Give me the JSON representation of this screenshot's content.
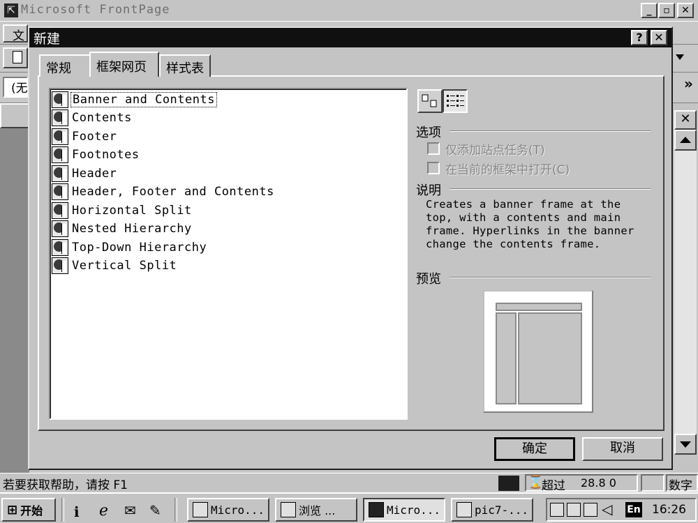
{
  "app": {
    "title": "Microsoft FrontPage",
    "min_glyph": "_",
    "max_glyph": "▫",
    "close_glyph": "✕"
  },
  "toolbars": {
    "menu_partial": "文",
    "style_partial": "(无",
    "overflow_glyph": "»"
  },
  "dialog": {
    "title": "新建",
    "help_glyph": "?",
    "close_glyph": "✕",
    "tabs": [
      {
        "label": "常规",
        "active": false
      },
      {
        "label": "框架网页",
        "active": true
      },
      {
        "label": "样式表",
        "active": false
      }
    ],
    "templates": [
      {
        "label": "Banner and Contents",
        "selected": true
      },
      {
        "label": "Contents",
        "selected": false
      },
      {
        "label": "Footer",
        "selected": false
      },
      {
        "label": "Footnotes",
        "selected": false
      },
      {
        "label": "Header",
        "selected": false
      },
      {
        "label": "Header, Footer and Contents",
        "selected": false
      },
      {
        "label": "Horizontal Split",
        "selected": false
      },
      {
        "label": "Nested Hierarchy",
        "selected": false
      },
      {
        "label": "Top-Down Hierarchy",
        "selected": false
      },
      {
        "label": "Vertical Split",
        "selected": false
      }
    ],
    "options": {
      "heading": "选项",
      "add_task_label": "仅添加站点任务(T)",
      "add_task_checked": false,
      "open_in_frame_label": "在当前的框架中打开(C)",
      "open_in_frame_checked": false
    },
    "description": {
      "heading": "说明",
      "text": "Creates a banner frame at the top, with a contents and main frame.  Hyperlinks in the banner change the contents frame."
    },
    "preview": {
      "heading": "预览"
    },
    "ok_label": "确定",
    "cancel_label": "取消"
  },
  "statusbar": {
    "help_text": "若要获取帮助，请按 F1",
    "timeout_label": "超过",
    "speed": "28.8 0",
    "mode": "数字"
  },
  "taskbar": {
    "start_label": "开始",
    "tasks": [
      {
        "label": "Micro..."
      },
      {
        "label": "浏览 ..."
      },
      {
        "label": "Micro..."
      },
      {
        "label": "pic7-..."
      }
    ],
    "lang": "En",
    "clock": "16:26"
  }
}
